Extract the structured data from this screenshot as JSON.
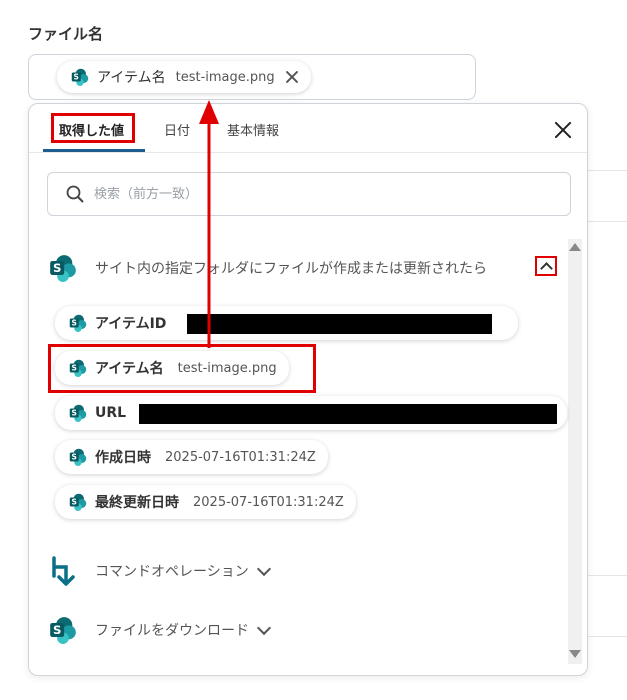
{
  "field": {
    "label": "ファイル名",
    "selected_chip": {
      "name": "アイテム名",
      "value": "test-image.png"
    }
  },
  "panel": {
    "tabs": [
      {
        "label": "取得した値",
        "active": true
      },
      {
        "label": "日付",
        "active": false
      },
      {
        "label": "基本情報",
        "active": false
      }
    ],
    "search": {
      "placeholder": "検索（前方一致）",
      "value": ""
    },
    "sections": [
      {
        "label": "サイト内の指定フォルダにファイルが作成または更新されたら",
        "icon": "sharepoint-icon",
        "expanded": true,
        "items": [
          {
            "name": "アイテムID",
            "value": ""
          },
          {
            "name": "アイテム名",
            "value": "test-image.png"
          },
          {
            "name": "URL",
            "value": ""
          },
          {
            "name": "作成日時",
            "value": "2025-07-16T01:31:24Z"
          },
          {
            "name": "最終更新日時",
            "value": "2025-07-16T01:31:24Z"
          }
        ]
      },
      {
        "label": "コマンドオペレーション",
        "icon": "command-operation-icon",
        "expanded": false
      },
      {
        "label": "ファイルをダウンロード",
        "icon": "sharepoint-icon",
        "expanded": false
      }
    ]
  },
  "colors": {
    "accent": "#1f5c8f",
    "highlight": "#e00000",
    "sharepoint": "#0f7b83",
    "command_icon": "#0d6f87"
  }
}
